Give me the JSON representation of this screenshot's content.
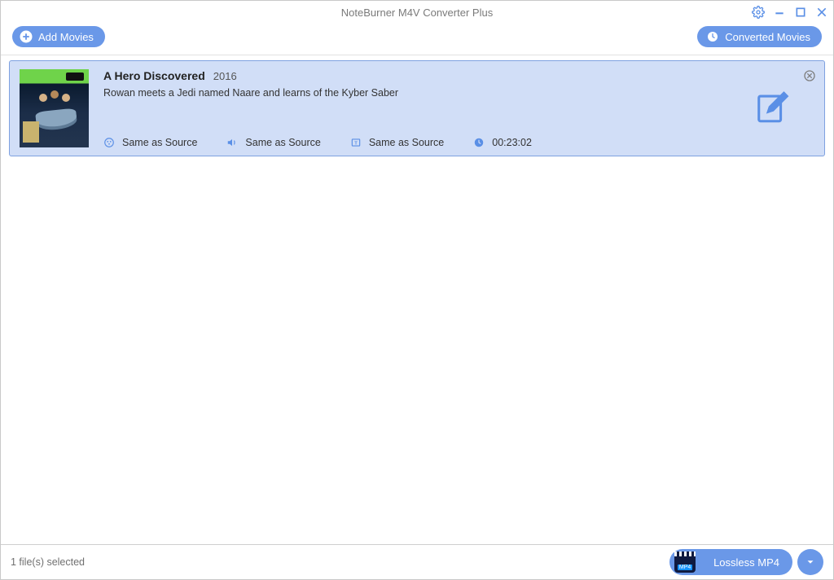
{
  "window": {
    "title": "NoteBurner M4V Converter Plus"
  },
  "toolbar": {
    "add_label": "Add Movies",
    "converted_label": "Converted Movies"
  },
  "movie": {
    "title": "A Hero Discovered",
    "year": "2016",
    "description": "Rowan meets a Jedi named Naare and learns of the Kyber Saber",
    "video_setting": "Same as Source",
    "audio_setting": "Same as Source",
    "subtitle_setting": "Same as Source",
    "duration": "00:23:02"
  },
  "status": {
    "selected_text": "1 file(s) selected",
    "format_label": "Lossless MP4",
    "mp4_badge": "MP4"
  }
}
